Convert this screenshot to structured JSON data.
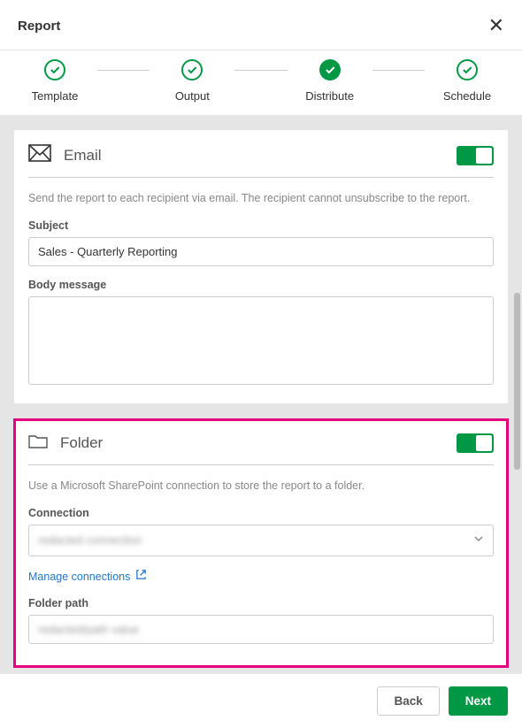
{
  "header": {
    "title": "Report"
  },
  "stepper": {
    "steps": [
      {
        "label": "Template",
        "state": "outline"
      },
      {
        "label": "Output",
        "state": "outline"
      },
      {
        "label": "Distribute",
        "state": "filled"
      },
      {
        "label": "Schedule",
        "state": "outline"
      }
    ]
  },
  "email_card": {
    "title": "Email",
    "toggle_on": true,
    "description": "Send the report to each recipient via email. The recipient cannot unsubscribe to the report.",
    "subject_label": "Subject",
    "subject_value": "Sales - Quarterly Reporting",
    "body_label": "Body message",
    "body_value": ""
  },
  "folder_card": {
    "title": "Folder",
    "toggle_on": true,
    "description": "Use a Microsoft SharePoint connection to store the report to a folder.",
    "connection_label": "Connection",
    "connection_value": "redacted connection",
    "manage_link": "Manage connections",
    "path_label": "Folder path",
    "path_value": "redacted/path value"
  },
  "footer": {
    "back_label": "Back",
    "next_label": "Next"
  }
}
